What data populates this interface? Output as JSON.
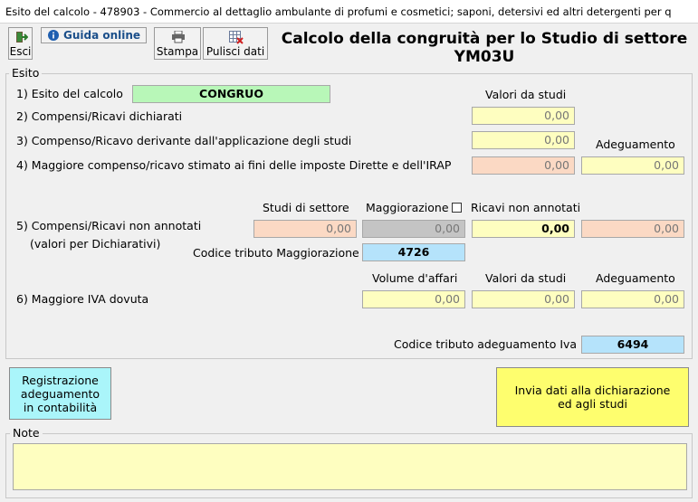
{
  "window_title": "Esito del calcolo - 478903 - Commercio al dettaglio ambulante di profumi e cosmetici; saponi, detersivi ed altri detergenti per q",
  "toolbar": {
    "esci": "Esci",
    "guida": "Guida online",
    "stampa": "Stampa",
    "pulisci": "Pulisci dati"
  },
  "heading": {
    "line1": "Calcolo della congruità per lo Studio di settore",
    "line2": "YM03U"
  },
  "esito": {
    "group_label": "Esito",
    "row1_label": "1) Esito del calcolo",
    "row1_value": "CONGRUO",
    "header_valori": "Valori da studi",
    "row2_label": "2) Compensi/Ricavi dichiarati",
    "row2_value": "0,00",
    "row3_label": "3) Compenso/Ricavo derivante dall'applicazione degli studi",
    "row3_value": "0,00",
    "header_adeguamento": "Adeguamento",
    "row4_label": "4) Maggiore compenso/ricavo stimato ai fini delle imposte Dirette e dell'IRAP",
    "row4_value": "0,00",
    "row4_adeguamento": "0,00",
    "header_studi_settore": "Studi di settore",
    "header_maggiorazione": "Maggiorazione",
    "maggiorazione_checked": false,
    "header_ricavi_non_annotati": "Ricavi non annotati",
    "row5_label": "5) Compensi/Ricavi non annotati",
    "row5_sublabel": "(valori per Dichiarativi)",
    "row5_studi": "0,00",
    "row5_maggiorazione": "0,00",
    "row5_ricavi": "0,00",
    "row5_adeguamento": "0,00",
    "codice_maggiorazione_label": "Codice tributo Maggiorazione",
    "codice_maggiorazione": "4726",
    "header_volume": "Volume d'affari",
    "header_valori2": "Valori da studi",
    "header_adeguamento2": "Adeguamento",
    "row6_label": "6) Maggiore IVA dovuta",
    "row6_volume": "0,00",
    "row6_valori": "0,00",
    "row6_adeguamento": "0,00",
    "codice_iva_label": "Codice tributo adeguamento Iva",
    "codice_iva": "6494"
  },
  "buttons": {
    "registrazione": "Registrazione adeguamento in contabilità",
    "invia": "Invia dati alla dichiarazione ed agli studi"
  },
  "note": {
    "group_label": "Note",
    "value": ""
  },
  "colors": {
    "yellow_field": "#fefec0",
    "peach_field": "#fbd9c4",
    "blue_field": "#b5e3fb",
    "green_field": "#b8f7b8",
    "registrazione_button": "#aaf5fa",
    "invia_button": "#fefe6e"
  }
}
